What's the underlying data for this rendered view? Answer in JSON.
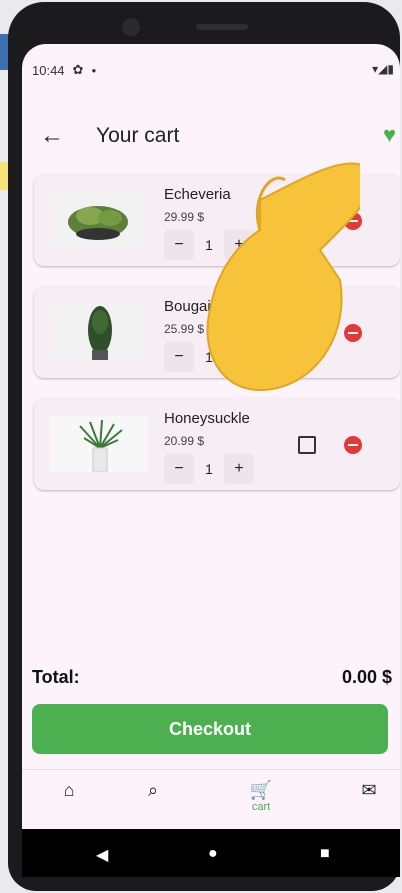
{
  "status": {
    "time": "10:44",
    "icons": [
      "gear-icon",
      "dot-icon"
    ],
    "right_icons": "▾◢▮"
  },
  "appbar": {
    "title": "Your cart"
  },
  "items": [
    {
      "name": "Echeveria",
      "price": "29.99 $",
      "qty": "1",
      "minus": "−",
      "plus": "+"
    },
    {
      "name": "Bougainvillea",
      "price": "25.99 $",
      "qty": "1",
      "minus": "−",
      "plus": "+"
    },
    {
      "name": "Honeysuckle",
      "price": "20.99 $",
      "qty": "1",
      "minus": "−",
      "plus": "+"
    }
  ],
  "summary": {
    "total_label": "Total:",
    "total_value": "0.00 $"
  },
  "checkout_label": "Checkout",
  "bottom_nav": {
    "cart_label": "cart"
  },
  "colors": {
    "accent": "#4caf50",
    "remove": "#e53935",
    "background": "#fcf3fb"
  }
}
